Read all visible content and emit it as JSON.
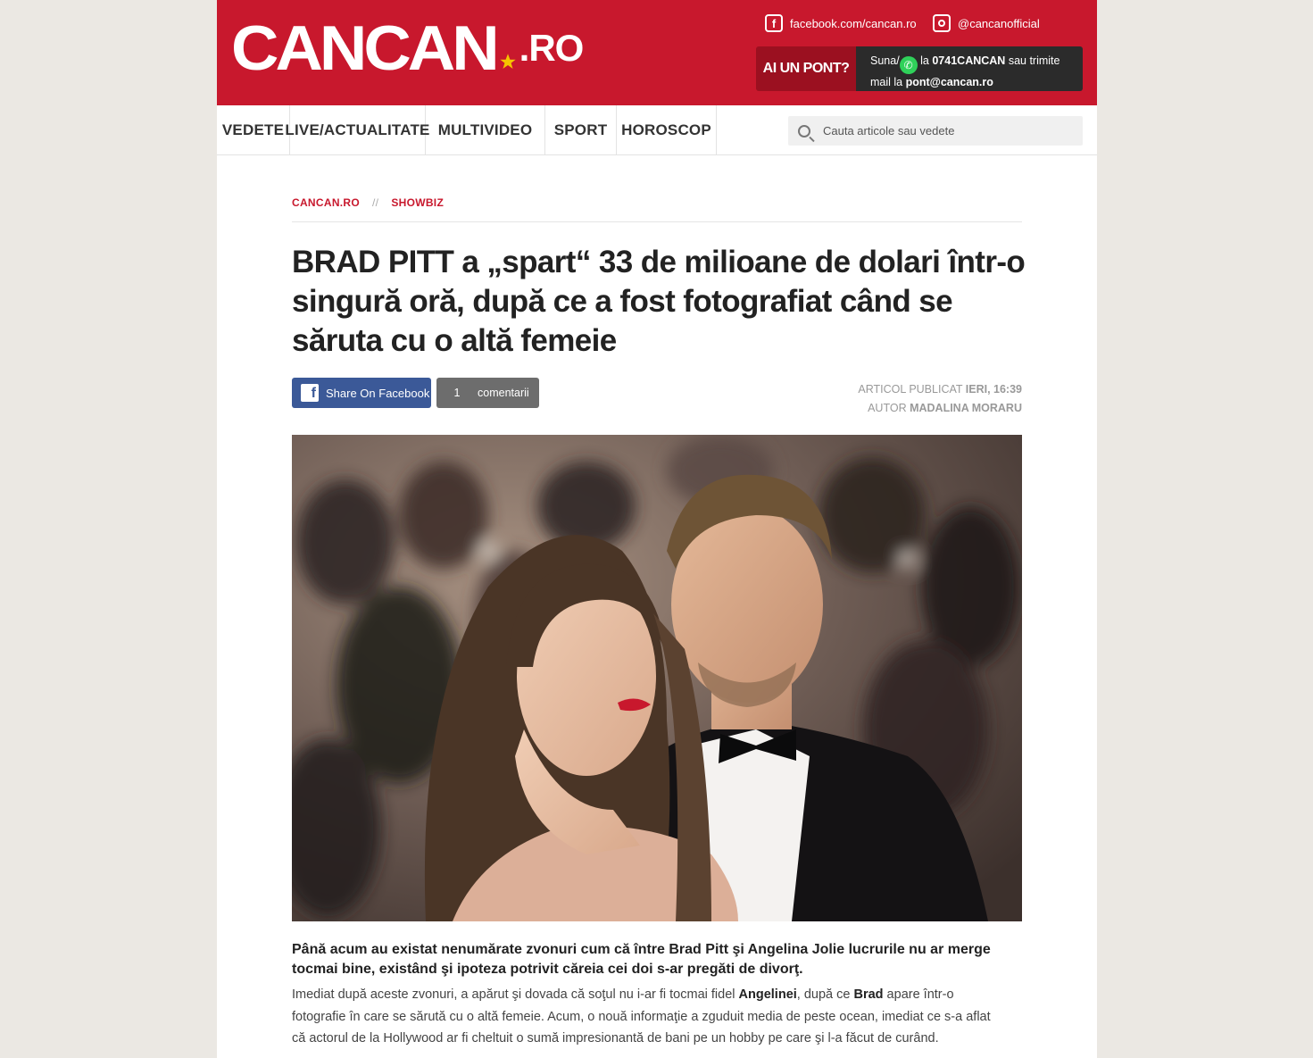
{
  "header": {
    "logo_main": "CANCAN",
    "logo_tld": ".RO",
    "facebook_label": "facebook.com/cancan.ro",
    "instagram_label": "@cancanofficial",
    "pont_label": "AI UN PONT?",
    "pont_line1_a": "Suna/",
    "pont_line1_b": " la ",
    "pont_phone": "0741CANCAN",
    "pont_line1_c": " sau trimite",
    "pont_line2_a": "mail la ",
    "pont_email": "pont@cancan.ro"
  },
  "nav": {
    "items": [
      "VEDETE",
      "LIVE/ACTUALITATE",
      "MULTIVIDEO",
      "SPORT",
      "HOROSCOP"
    ],
    "search_placeholder": "Cauta articole sau vedete"
  },
  "breadcrumb": {
    "home": "CANCAN.RO",
    "separator": "//",
    "section": "SHOWBIZ"
  },
  "article": {
    "title": "BRAD PITT a „spart“ 33 de milioane de dolari într-o singură oră, după ce a fost fotografiat când se săruta cu o altă femeie",
    "share_label": "Share On Facebook",
    "comments_count": "1",
    "comments_label": "comentarii",
    "published_label": "ARTICOL PUBLICAT ",
    "published_value": "IERI, 16:39",
    "author_label": "AUTOR ",
    "author_value": "MADALINA MORARU",
    "lead": "Până acum au existat nenumărate zvonuri cum că între Brad Pitt şi Angelina Jolie lucrurile nu ar merge tocmai bine, existând şi ipoteza potrivit căreia cei doi s-ar pregăti de divorţ.",
    "body_a": "Imediat după aceste zvonuri, a apărut şi dovada că soţul nu i-ar fi tocmai fidel ",
    "body_b": "Angelinei",
    "body_c": ", după ce ",
    "body_d": "Brad",
    "body_e": " apare într-o fotografie în care se sărută cu o altă femeie. Acum, o nouă informaţie a zguduit media de peste ocean, imediat ce s-a aflat că actorul de la Hollywood ar fi cheltuit o sumă impresionantă de bani pe un hobby pe care şi l-a făcut de curând."
  },
  "colors": {
    "brand_red": "#c8182d",
    "facebook_blue": "#3b5998",
    "page_bg": "#ebe8e3"
  }
}
